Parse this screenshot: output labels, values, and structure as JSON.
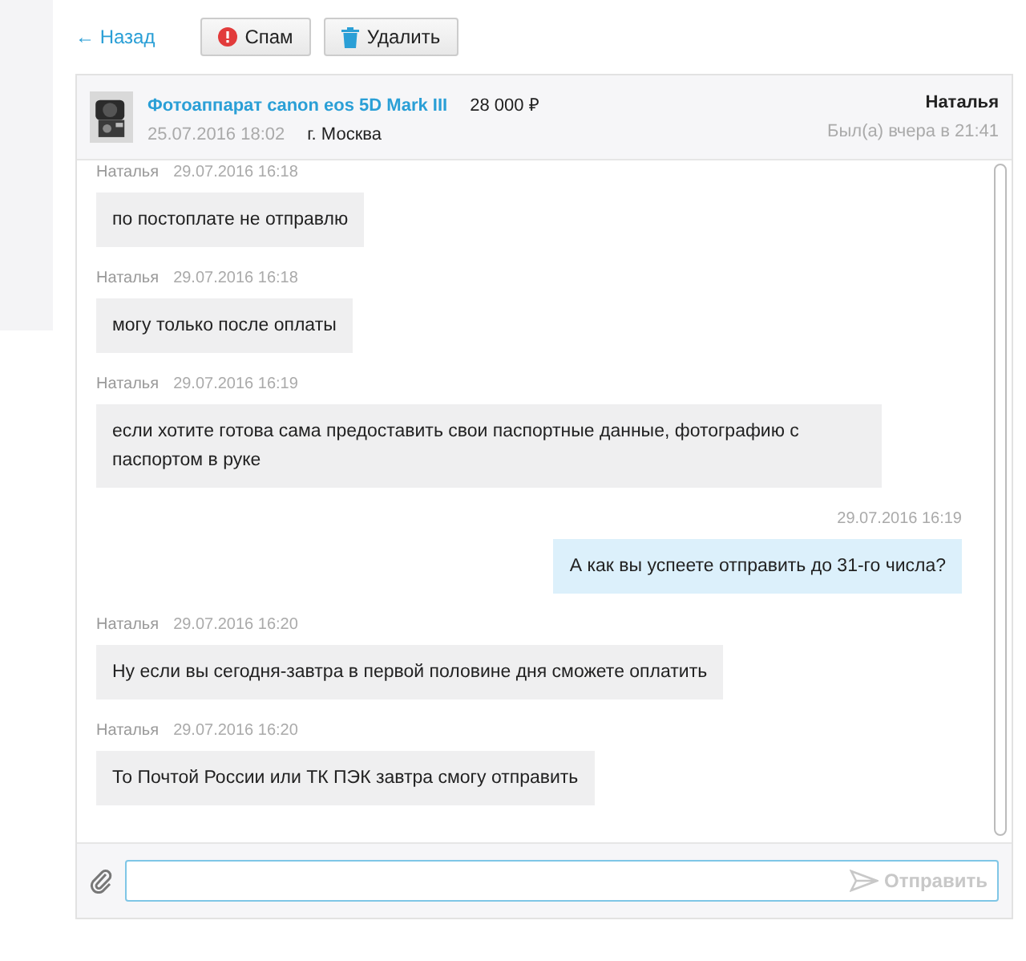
{
  "nav": {
    "back": "← Назад",
    "buttons": [
      {
        "kind": "spam",
        "label": "Спам"
      },
      {
        "kind": "delete",
        "label": "Удалить"
      }
    ]
  },
  "ad": {
    "title": "Фотоаппарат canon eos 5D Mark III",
    "price": "28 000 ₽",
    "date": "25.07.2016 18:02",
    "city": "г. Москва",
    "user": "Наталья",
    "last_seen": "Был(а) вчера в 21:41"
  },
  "messages": [
    {
      "own": false,
      "author": "Наталья",
      "time": "29.07.2016 16:18",
      "text": "по постоплате не отправлю"
    },
    {
      "own": false,
      "author": "Наталья",
      "time": "29.07.2016 16:18",
      "text": "могу только после оплаты"
    },
    {
      "own": false,
      "author": "Наталья",
      "time": "29.07.2016 16:19",
      "text": "если хотите готова сама предоставить свои паспортные данные, фотографию с паспортом в руке"
    },
    {
      "own": true,
      "time": "29.07.2016 16:19",
      "text": "А как вы успеете отправить до 31-го числа?"
    },
    {
      "own": false,
      "author": "Наталья",
      "time": "29.07.2016 16:20",
      "text": "Ну если вы сегодня-завтра в первой половине дня сможете оплатить"
    },
    {
      "own": false,
      "author": "Наталья",
      "time": "29.07.2016 16:20",
      "text": "То Почтой России или ТК ПЭК завтра смогу отправить"
    }
  ],
  "composer": {
    "send": "Отправить"
  }
}
